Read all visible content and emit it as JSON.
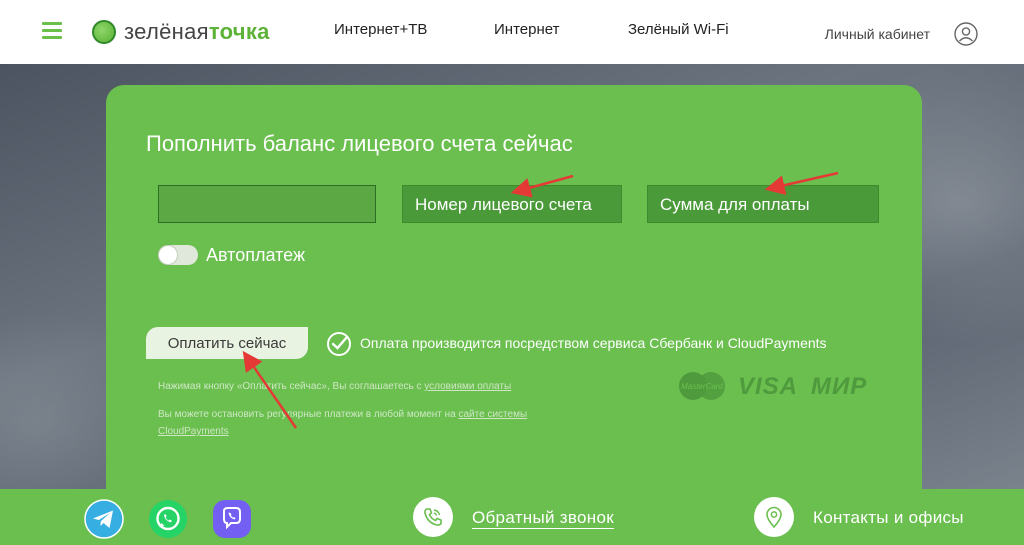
{
  "header": {
    "logo_part1": "зелёная",
    "logo_part2": "точка",
    "nav": [
      "Интернет+ТВ",
      "Интернет",
      "Зелёный Wi-Fi"
    ],
    "login_label": "Личный кабинет"
  },
  "payment": {
    "title": "Пополнить баланс лицевого счета сейчас",
    "field1_value": "",
    "field2_value": "Номер лицевого счета",
    "field3_value": "Сумма для оплаты",
    "autopay_label": "Автоплатеж",
    "pay_button": "Оплатить сейчас",
    "service_note": "Оплата производится посредством сервиса Сбербанк и CloudPayments",
    "agree_text": "Нажимая кнопку «Оплатить сейчас», Вы соглашаетесь с ",
    "agree_link": "условиями оплаты",
    "cancel_text": "Вы можете остановить регулярные платежи в любой момент на ",
    "cancel_link1": "сайте системы",
    "cancel_link2": "CloudPayments",
    "mastercard_label": "MasterCard",
    "visa_label": "VISA",
    "mir_label": "МИР"
  },
  "footer": {
    "callback_label": "Обратный звонок",
    "contacts_label": "Контакты и офисы"
  },
  "colors": {
    "brand_green": "#6abf4f",
    "field_green": "#4a9a3a",
    "arrow_red": "#e53935",
    "telegram": "#37aee2",
    "whatsapp": "#25d366",
    "viber": "#7360f2"
  },
  "icons": {
    "menu": "hamburger-icon",
    "user": "user-icon",
    "sber": "sberbank-icon",
    "telegram": "telegram-icon",
    "whatsapp": "whatsapp-icon",
    "viber": "viber-icon",
    "callback": "phone-icon",
    "contacts": "location-pin-icon"
  }
}
